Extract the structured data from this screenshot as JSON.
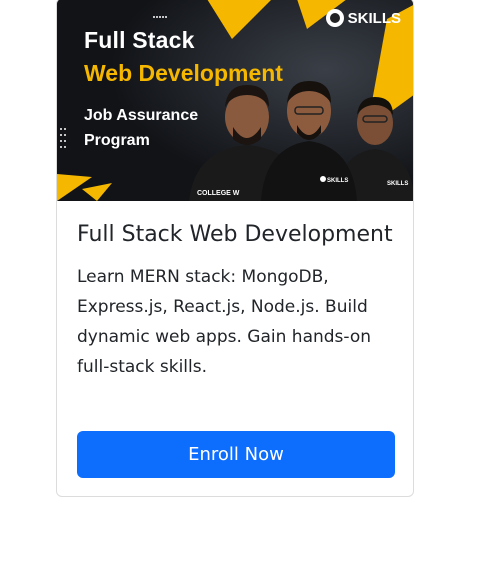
{
  "banner": {
    "brand": "SKILLS",
    "title_line1": "Full Stack",
    "title_line2": "Web Development",
    "subtitle": "Job Assurance Program",
    "shirt_text": "COLLEGE W",
    "shirt_badge": "SKILLS"
  },
  "card": {
    "title": "Full Stack Web Development",
    "description": "Learn MERN stack: MongoDB, Express.js, React.js, Node.js. Build dynamic web apps. Gain hands-on full-stack skills.",
    "button_label": "Enroll Now"
  },
  "colors": {
    "accent_yellow": "#f5b700",
    "button_blue": "#0d6efd",
    "banner_bg": "#111317"
  }
}
